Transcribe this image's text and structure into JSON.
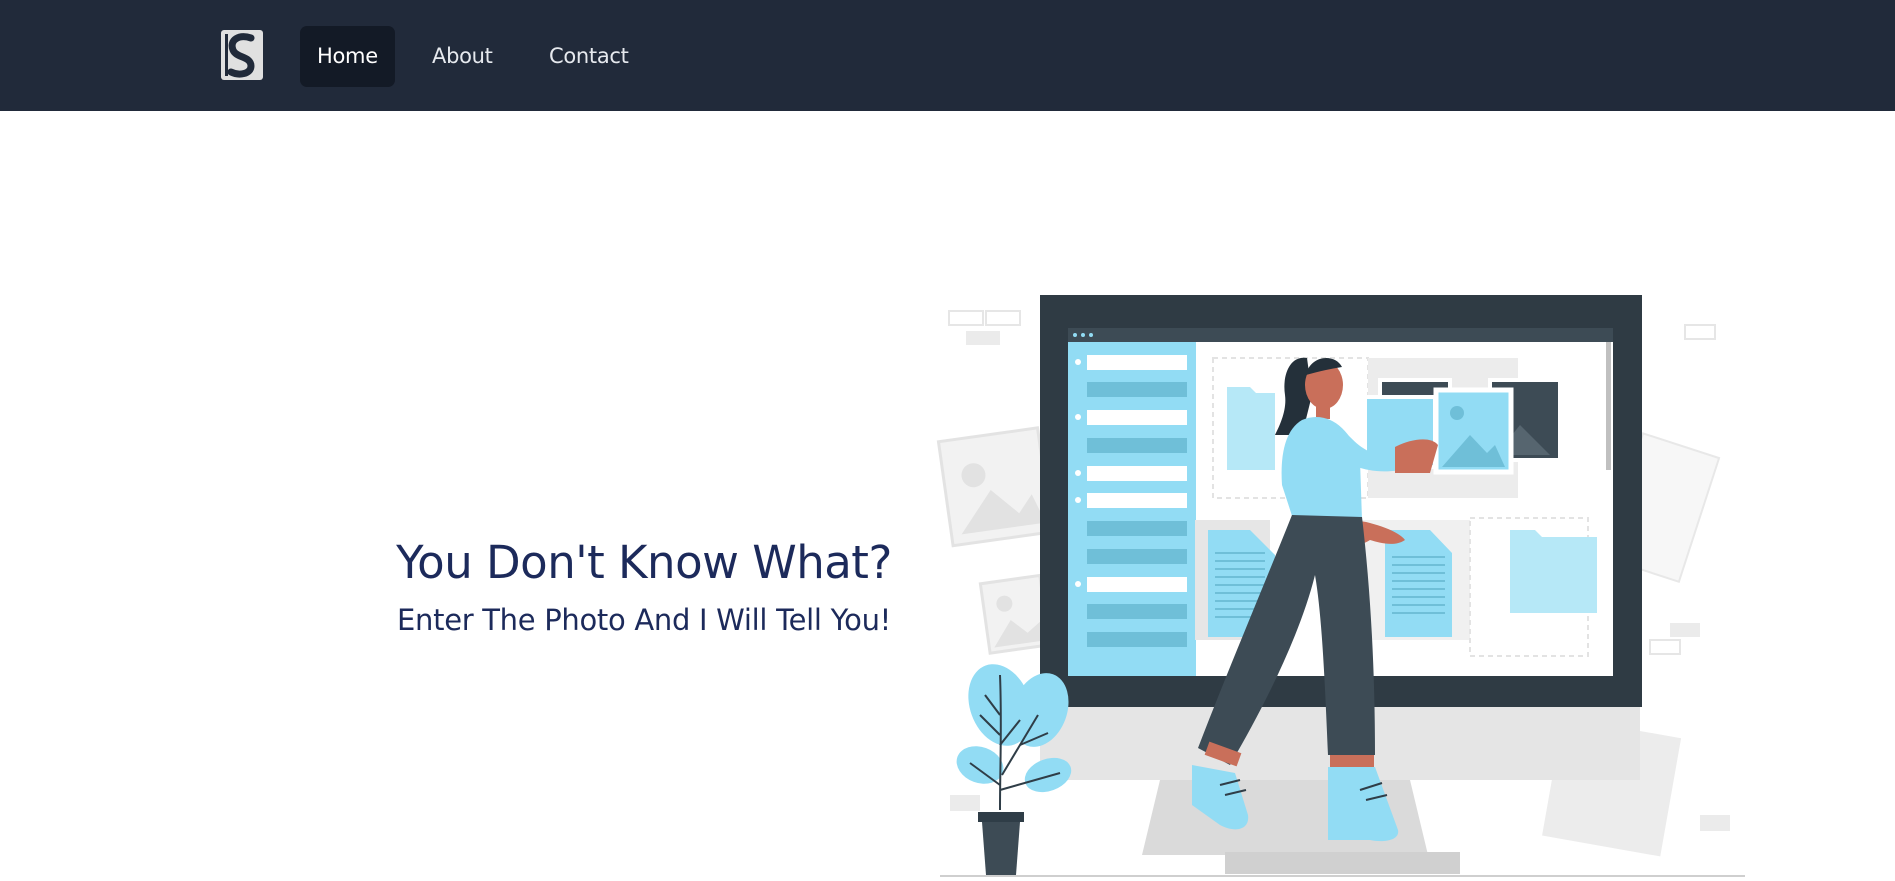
{
  "nav": {
    "logo_icon": "stylized-s-logo-icon",
    "links": [
      {
        "label": "Home",
        "active": true
      },
      {
        "label": "About",
        "active": false
      },
      {
        "label": "Contact",
        "active": false
      }
    ]
  },
  "hero": {
    "title": "You Don't Know What?",
    "subtitle": "Enter The Photo And I Will Tell You!"
  },
  "illustration": {
    "icon": "woman-organizing-photos-illustration",
    "accent_color": "#92dcf4",
    "dark_color": "#2f3d47"
  }
}
